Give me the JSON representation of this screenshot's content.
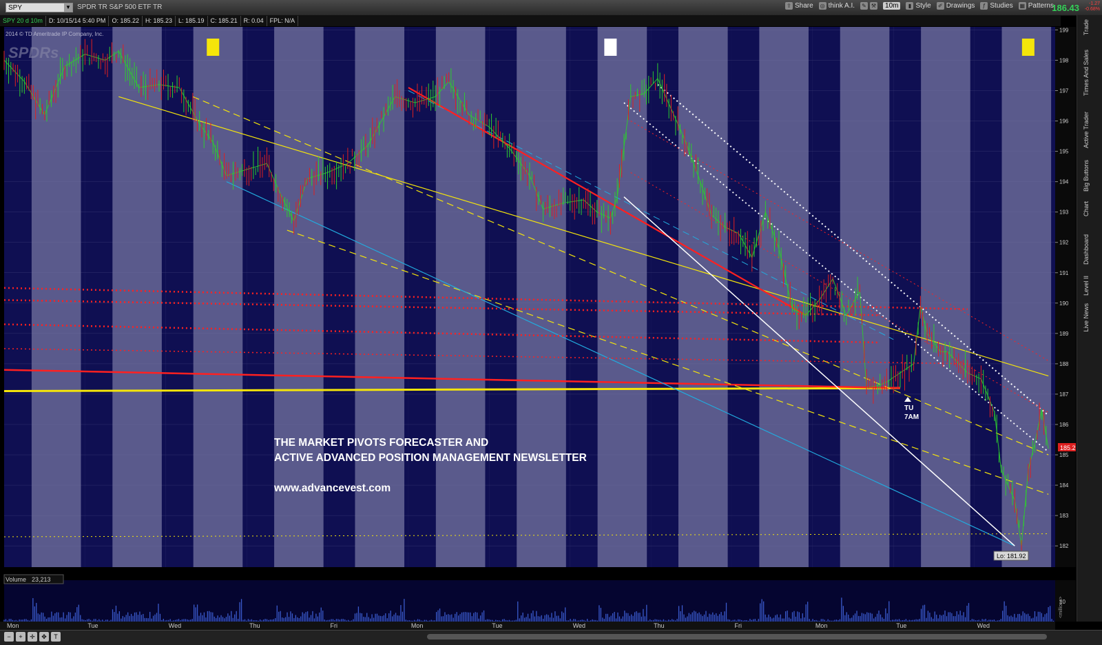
{
  "toolbar": {
    "symbol": "SPY",
    "description": "SPDR TR S&P 500 ETF TR",
    "share": "Share",
    "think": "think A.I.",
    "timeframe": "10m",
    "style": "Style",
    "drawings": "Drawings",
    "studies": "Studies",
    "patterns": "Patterns",
    "last_price": "186.43",
    "change_1": "-1.27",
    "change_2": "-0.68%"
  },
  "infobar": {
    "chart_id": "SPY 20 d 10m",
    "date": "D: 10/15/14 5:40 PM",
    "open": "O: 185.22",
    "high": "H: 185.23",
    "low": "L: 185.19",
    "close": "C: 185.21",
    "range": "R: 0.04",
    "fpl": "FPL: N/A"
  },
  "side_tabs": [
    "Trade",
    "Times And Sales",
    "Active Trader",
    "Big Buttons",
    "Chart",
    "Dashboard",
    "Level II",
    "Live News"
  ],
  "colors": {
    "panel_light": "#5a5a8c",
    "panel_dark": "#0f0f52",
    "price_up": "#2ecc2e",
    "price_down": "#e02020",
    "yellow": "#f5e50a",
    "red": "#ff2020",
    "cyan": "#22aadd",
    "white": "#ffffff",
    "volume": "#3a5acc"
  },
  "chart_data": {
    "type": "line",
    "copyright": "2014 © TD Ameritrade IP Company, Inc.",
    "watermark": "SPDRs",
    "x_day_labels": [
      "Mon",
      "Tue",
      "Wed",
      "Thu",
      "Fri",
      "Mon",
      "Tue",
      "Wed",
      "Thu",
      "Fri",
      "Mon",
      "Tue",
      "Wed"
    ],
    "yticks": [
      182,
      183,
      184,
      185,
      186,
      187,
      188,
      189,
      190,
      191,
      192,
      193,
      194,
      195,
      196,
      197,
      198,
      199
    ],
    "ylim": [
      181.3,
      199.1
    ],
    "price_path": [
      [
        0,
        198.0
      ],
      [
        3,
        197.3
      ],
      [
        6,
        196.2
      ],
      [
        9,
        197.8
      ],
      [
        12,
        198.2
      ],
      [
        15,
        198.0
      ],
      [
        17,
        198.3
      ],
      [
        20,
        197.1
      ],
      [
        23,
        197.2
      ],
      [
        26,
        197.1
      ],
      [
        29,
        195.9
      ],
      [
        31,
        195.3
      ],
      [
        33,
        194.2
      ],
      [
        36,
        194.4
      ],
      [
        39,
        194.6
      ],
      [
        41,
        193.6
      ],
      [
        43,
        192.7
      ],
      [
        45,
        194.1
      ],
      [
        48,
        194.3
      ],
      [
        51,
        194.6
      ],
      [
        54,
        195.2
      ],
      [
        56,
        196.0
      ],
      [
        58,
        196.8
      ],
      [
        61,
        196.6
      ],
      [
        64,
        196.8
      ],
      [
        66,
        197.3
      ],
      [
        69,
        196.2
      ],
      [
        72,
        195.8
      ],
      [
        75,
        195.1
      ],
      [
        78,
        194.2
      ],
      [
        80,
        193.1
      ],
      [
        83,
        193.3
      ],
      [
        86,
        193.4
      ],
      [
        88,
        193.0
      ],
      [
        90,
        192.8
      ],
      [
        91,
        193.5
      ],
      [
        93,
        196.8
      ],
      [
        95,
        196.9
      ],
      [
        97,
        197.4
      ],
      [
        99,
        196.4
      ],
      [
        101,
        195.4
      ],
      [
        103,
        194.2
      ],
      [
        105,
        192.9
      ],
      [
        107,
        192.5
      ],
      [
        109,
        192.3
      ],
      [
        111,
        191.5
      ],
      [
        113,
        193.0
      ],
      [
        115,
        191.8
      ],
      [
        117,
        189.8
      ],
      [
        119,
        189.6
      ],
      [
        121,
        190.1
      ],
      [
        123,
        190.8
      ],
      [
        125,
        189.6
      ],
      [
        127,
        190.4
      ],
      [
        128,
        187.2
      ],
      [
        130,
        187.3
      ],
      [
        131,
        187.4
      ],
      [
        133,
        187.7
      ],
      [
        135,
        188.0
      ],
      [
        136,
        189.9
      ],
      [
        137,
        189.0
      ],
      [
        139,
        188.4
      ],
      [
        140,
        188.4
      ],
      [
        143,
        187.7
      ],
      [
        145,
        187.5
      ],
      [
        147,
        186.4
      ],
      [
        148,
        184.5
      ],
      [
        150,
        183.5
      ],
      [
        151,
        182.0
      ],
      [
        152,
        184.5
      ],
      [
        153,
        185.4
      ],
      [
        154,
        186.5
      ],
      [
        155,
        185.2
      ]
    ],
    "volume_label": "Volume",
    "volume_value": "23,213",
    "volume_axis_tick": "10",
    "volume_unit": "<millions>",
    "current_price_label": "185.21",
    "low_label": "Lo: 181.92",
    "marker_label_1": "TU",
    "marker_label_2": "7AM",
    "newsletter_line1": "THE MARKET PIVOTS FORECASTER AND",
    "newsletter_line2": "ACTIVE ADVANCED POSITION MANAGEMENT NEWSLETTER",
    "newsletter_url": "www.advancevest.com",
    "trendlines": [
      {
        "color": "yellow",
        "style": "solid",
        "width": 3,
        "p1": [
          0,
          187.1
        ],
        "p2": [
          133,
          187.2
        ]
      },
      {
        "color": "red",
        "style": "solid",
        "width": 2.5,
        "p1": [
          0,
          187.8
        ],
        "p2": [
          133,
          187.2
        ]
      },
      {
        "color": "yellow",
        "style": "solid",
        "width": 1.2,
        "p1": [
          17,
          196.8
        ],
        "p2": [
          155,
          187.6
        ]
      },
      {
        "color": "yellow",
        "style": "dashed",
        "width": 1.2,
        "p1": [
          28,
          196.8
        ],
        "p2": [
          155,
          185.0
        ]
      },
      {
        "color": "yellow",
        "style": "dashed",
        "width": 1.2,
        "p1": [
          42,
          192.4
        ],
        "p2": [
          155,
          183.7
        ]
      },
      {
        "color": "cyan",
        "style": "solid",
        "width": 1.2,
        "p1": [
          33,
          194.0
        ],
        "p2": [
          150,
          182.0
        ]
      },
      {
        "color": "cyan",
        "style": "dashed",
        "width": 1,
        "p1": [
          60,
          197.0
        ],
        "p2": [
          132,
          188.8
        ]
      },
      {
        "color": "red",
        "style": "solid",
        "width": 2.2,
        "p1": [
          60,
          197.1
        ],
        "p2": [
          119,
          189.6
        ]
      },
      {
        "color": "white",
        "style": "solid",
        "width": 1.5,
        "p1": [
          92,
          193.5
        ],
        "p2": [
          150,
          182.0
        ]
      },
      {
        "color": "white",
        "style": "dotted",
        "width": 2,
        "p1": [
          97,
          197.2
        ],
        "p2": [
          155,
          186.3
        ]
      },
      {
        "color": "white",
        "style": "dotted",
        "width": 1.8,
        "p1": [
          92,
          196.6
        ],
        "p2": [
          155,
          185.1
        ]
      },
      {
        "color": "red",
        "style": "dotted",
        "width": 1,
        "p1": [
          93,
          196.0
        ],
        "p2": [
          155,
          188.1
        ]
      },
      {
        "color": "red",
        "style": "dotted",
        "width": 1,
        "p1": [
          93,
          194.3
        ],
        "p2": [
          155,
          186.4
        ]
      },
      {
        "color": "red",
        "style": "dotted",
        "width": 2.5,
        "p1": [
          0,
          190.5
        ],
        "p2": [
          143,
          189.8
        ]
      },
      {
        "color": "red",
        "style": "dotted",
        "width": 2.5,
        "p1": [
          0,
          189.3
        ],
        "p2": [
          130,
          188.7
        ]
      },
      {
        "color": "red",
        "style": "dotted",
        "width": 1.5,
        "p1": [
          0,
          188.5
        ],
        "p2": [
          143,
          188.0
        ]
      },
      {
        "color": "red",
        "style": "dotted",
        "width": 2.5,
        "p1": [
          0,
          190.1
        ],
        "p2": [
          130,
          189.6
        ]
      },
      {
        "color": "yellow",
        "style": "dotted",
        "width": 1,
        "p1": [
          0,
          182.3
        ],
        "p2": [
          155,
          182.4
        ]
      }
    ],
    "markers": [
      {
        "x": 31,
        "color": "yellow"
      },
      {
        "x": 90,
        "color": "white"
      },
      {
        "x": 152,
        "color": "yellow"
      }
    ]
  }
}
